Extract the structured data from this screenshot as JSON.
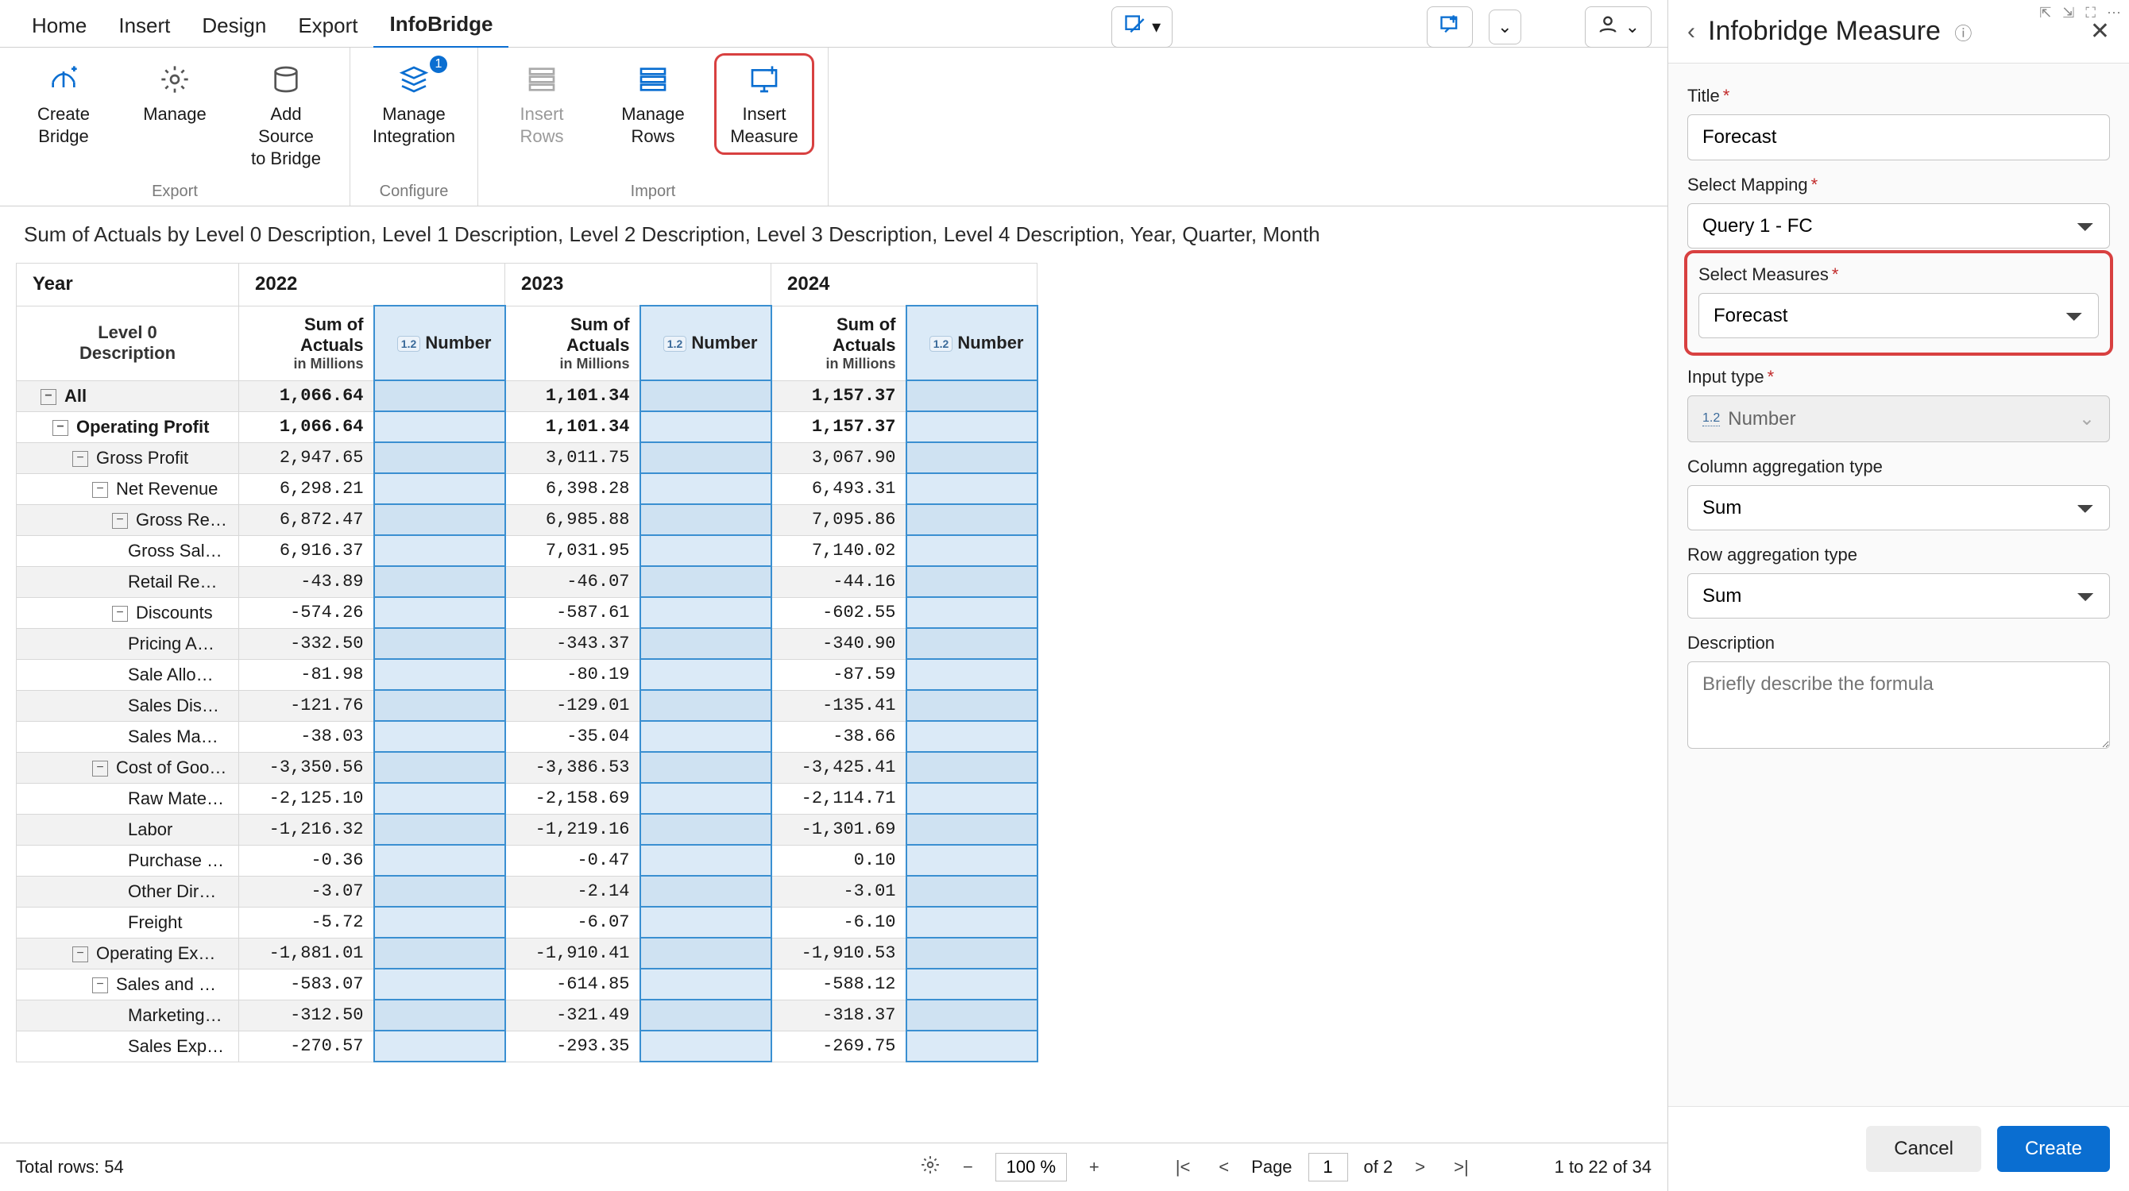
{
  "tabs": {
    "home": "Home",
    "insert": "Insert",
    "design": "Design",
    "export": "Export",
    "infobridge": "InfoBridge"
  },
  "ribbon": {
    "export_group": "Export",
    "configure_group": "Configure",
    "import_group": "Import",
    "create_bridge": "Create\nBridge",
    "manage": "Manage",
    "add_source": "Add Source\nto Bridge",
    "manage_integration": "Manage\nIntegration",
    "insert_rows": "Insert\nRows",
    "manage_rows": "Manage\nRows",
    "insert_measure": "Insert\nMeasure"
  },
  "chart_title": "Sum of Actuals by Level 0 Description, Level 1 Description, Level 2 Description, Level 3 Description, Level 4 Description, Year, Quarter, Month",
  "table": {
    "year_label": "Year",
    "years": [
      "2022",
      "2023",
      "2024"
    ],
    "level_label": "Level 0\nDescription",
    "sum_label": "Sum of\nActuals",
    "sum_sub": "in Millions",
    "number_label": "Number",
    "numtype": "1.2",
    "rows": [
      {
        "indent": 0,
        "toggle": true,
        "label": "All",
        "vals": [
          "1,066.64",
          "1,101.34",
          "1,157.37"
        ],
        "bold": true
      },
      {
        "indent": 1,
        "toggle": true,
        "label": "Operating Profit",
        "vals": [
          "1,066.64",
          "1,101.34",
          "1,157.37"
        ],
        "bold": true
      },
      {
        "indent": 2,
        "toggle": true,
        "label": "Gross Profit",
        "vals": [
          "2,947.65",
          "3,011.75",
          "3,067.90"
        ]
      },
      {
        "indent": 3,
        "toggle": true,
        "label": "Net Revenue",
        "vals": [
          "6,298.21",
          "6,398.28",
          "6,493.31"
        ]
      },
      {
        "indent": 4,
        "toggle": true,
        "label": "Gross Rev…",
        "vals": [
          "6,872.47",
          "6,985.88",
          "7,095.86"
        ]
      },
      {
        "indent": 5,
        "toggle": false,
        "label": "Gross Sal…",
        "vals": [
          "6,916.37",
          "7,031.95",
          "7,140.02"
        ]
      },
      {
        "indent": 5,
        "toggle": false,
        "label": "Retail Re…",
        "vals": [
          "-43.89",
          "-46.07",
          "-44.16"
        ]
      },
      {
        "indent": 4,
        "toggle": true,
        "label": "Discounts",
        "vals": [
          "-574.26",
          "-587.61",
          "-602.55"
        ]
      },
      {
        "indent": 5,
        "toggle": false,
        "label": "Pricing A…",
        "vals": [
          "-332.50",
          "-343.37",
          "-340.90"
        ]
      },
      {
        "indent": 5,
        "toggle": false,
        "label": "Sale Allo…",
        "vals": [
          "-81.98",
          "-80.19",
          "-87.59"
        ]
      },
      {
        "indent": 5,
        "toggle": false,
        "label": "Sales Dis…",
        "vals": [
          "-121.76",
          "-129.01",
          "-135.41"
        ]
      },
      {
        "indent": 5,
        "toggle": false,
        "label": "Sales Ma…",
        "vals": [
          "-38.03",
          "-35.04",
          "-38.66"
        ]
      },
      {
        "indent": 3,
        "toggle": true,
        "label": "Cost of Goo…",
        "vals": [
          "-3,350.56",
          "-3,386.53",
          "-3,425.41"
        ]
      },
      {
        "indent": 5,
        "toggle": false,
        "label": "Raw Mate…",
        "vals": [
          "-2,125.10",
          "-2,158.69",
          "-2,114.71"
        ]
      },
      {
        "indent": 5,
        "toggle": false,
        "label": "Labor",
        "vals": [
          "-1,216.32",
          "-1,219.16",
          "-1,301.69"
        ]
      },
      {
        "indent": 5,
        "toggle": false,
        "label": "Purchase …",
        "vals": [
          "-0.36",
          "-0.47",
          "0.10"
        ]
      },
      {
        "indent": 5,
        "toggle": false,
        "label": "Other Dir…",
        "vals": [
          "-3.07",
          "-2.14",
          "-3.01"
        ]
      },
      {
        "indent": 5,
        "toggle": false,
        "label": "Freight",
        "vals": [
          "-5.72",
          "-6.07",
          "-6.10"
        ]
      },
      {
        "indent": 2,
        "toggle": true,
        "label": "Operating Ex…",
        "vals": [
          "-1,881.01",
          "-1,910.41",
          "-1,910.53"
        ]
      },
      {
        "indent": 3,
        "toggle": true,
        "label": "Sales and M…",
        "vals": [
          "-583.07",
          "-614.85",
          "-588.12"
        ]
      },
      {
        "indent": 5,
        "toggle": false,
        "label": "Marketing…",
        "vals": [
          "-312.50",
          "-321.49",
          "-318.37"
        ]
      },
      {
        "indent": 5,
        "toggle": false,
        "label": "Sales Exp…",
        "vals": [
          "-270.57",
          "-293.35",
          "-269.75"
        ]
      }
    ]
  },
  "footer": {
    "total_rows": "Total rows: 54",
    "zoom": "100 %",
    "page_label": "Page",
    "page_current": "1",
    "page_of": "of 2",
    "range": "1 to 22 of 34"
  },
  "panel": {
    "title": "Infobridge Measure",
    "f_title_label": "Title",
    "f_title_value": "Forecast",
    "f_mapping_label": "Select Mapping",
    "f_mapping_value": "Query 1 - FC",
    "f_measures_label": "Select Measures",
    "f_measures_value": "Forecast",
    "f_inputtype_label": "Input type",
    "f_inputtype_value": "Number",
    "f_inputtype_prefix": "1.2",
    "f_colagg_label": "Column aggregation type",
    "f_colagg_value": "Sum",
    "f_rowagg_label": "Row aggregation type",
    "f_rowagg_value": "Sum",
    "f_desc_label": "Description",
    "f_desc_placeholder": "Briefly describe the formula",
    "cancel": "Cancel",
    "create": "Create"
  }
}
